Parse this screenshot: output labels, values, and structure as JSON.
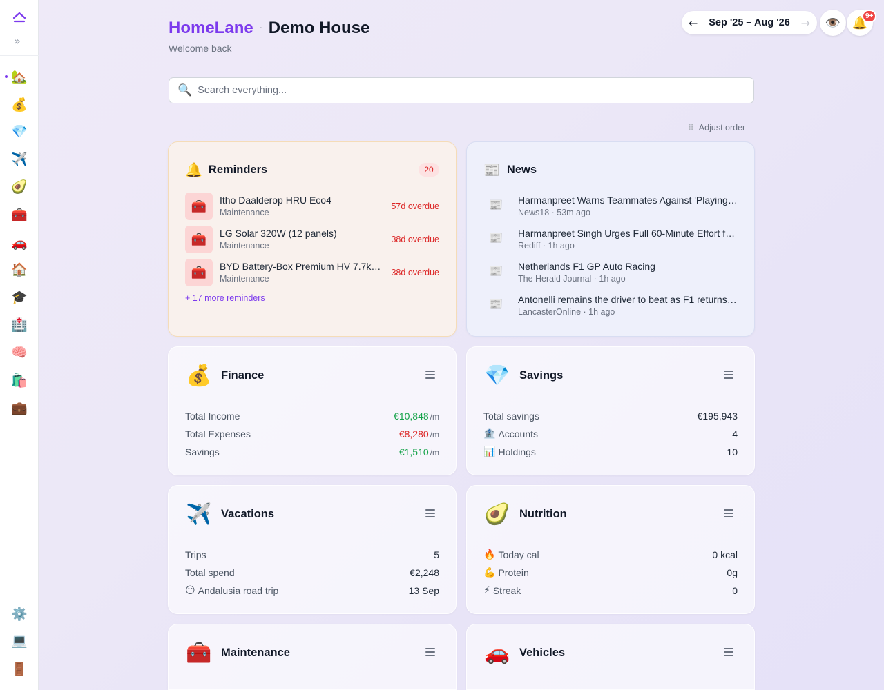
{
  "sidebar": {
    "logo": "homelane-logo",
    "expand": "»",
    "items": [
      {
        "icon": "🏡",
        "name": "house-icon",
        "active": true
      },
      {
        "icon": "💰",
        "name": "money-bag-icon"
      },
      {
        "icon": "💎",
        "name": "gem-icon"
      },
      {
        "icon": "✈️",
        "name": "airplane-icon"
      },
      {
        "icon": "🥑",
        "name": "avocado-icon"
      },
      {
        "icon": "🧰",
        "name": "toolbox-icon"
      },
      {
        "icon": "🚗",
        "name": "car-icon"
      },
      {
        "icon": "🏠",
        "name": "home-icon"
      },
      {
        "icon": "🎓",
        "name": "graduation-cap-icon"
      },
      {
        "icon": "🏥",
        "name": "hospital-icon"
      },
      {
        "icon": "🧠",
        "name": "brain-icon"
      },
      {
        "icon": "🛍️",
        "name": "shopping-bags-icon"
      },
      {
        "icon": "💼",
        "name": "briefcase-icon"
      }
    ],
    "bottom": [
      {
        "icon": "⚙️",
        "name": "gear-icon"
      },
      {
        "icon": "💻",
        "name": "laptop-icon"
      },
      {
        "icon": "🚪",
        "name": "door-icon"
      }
    ]
  },
  "header": {
    "app_name": "HomeLane",
    "separator": "·",
    "house_name": "Demo House",
    "welcome": "Welcome back",
    "range": "Sep '25 – Aug '26",
    "prev_arrow": "←",
    "next_arrow": "→",
    "eye": "👁️",
    "bell": "🔔",
    "notif_count": "9+"
  },
  "search": {
    "icon": "🔍",
    "placeholder": "Search everything..."
  },
  "adjust": {
    "grip": "⠿",
    "label": "Adjust order"
  },
  "reminders": {
    "icon": "🔔",
    "title": "Reminders",
    "count": "20",
    "items": [
      {
        "icon": "🧰",
        "name": "Itho Daalderop HRU Eco4",
        "category": "Maintenance",
        "status": "57d overdue"
      },
      {
        "icon": "🧰",
        "name": "LG Solar 320W (12 panels)",
        "category": "Maintenance",
        "status": "38d overdue"
      },
      {
        "icon": "🧰",
        "name": "BYD Battery-Box Premium HV 7.7kWh",
        "category": "Maintenance",
        "status": "38d overdue"
      }
    ],
    "more": "+ 17 more reminders"
  },
  "news": {
    "icon": "📰",
    "title": "News",
    "items": [
      {
        "icon": "📰",
        "title": "Harmanpreet Warns Teammates Against 'Playing Safe'",
        "meta": "News18 · 53m ago"
      },
      {
        "icon": "📰",
        "title": "Harmanpreet Singh Urges Full 60-Minute Effort from Team",
        "meta": "Rediff · 1h ago"
      },
      {
        "icon": "📰",
        "title": "Netherlands F1 GP Auto Racing",
        "meta": "The Herald Journal · 1h ago"
      },
      {
        "icon": "📰",
        "title": "Antonelli remains the driver to beat as F1 returns to Europe",
        "meta": "LancasterOnline · 1h ago"
      }
    ]
  },
  "finance": {
    "icon": "💰",
    "title": "Finance",
    "rows": [
      {
        "label": "Total Income",
        "value": "€10,848",
        "unit": "/m",
        "color": "green"
      },
      {
        "label": "Total Expenses",
        "value": "€8,280",
        "unit": "/m",
        "color": "red"
      },
      {
        "label": "Savings",
        "value": "€1,510",
        "unit": "/m",
        "color": "green"
      }
    ]
  },
  "savings": {
    "icon": "💎",
    "title": "Savings",
    "rows": [
      {
        "emoji": "",
        "label": "Total savings",
        "value": "€195,943"
      },
      {
        "emoji": "🏦",
        "label": "Accounts",
        "value": "4"
      },
      {
        "emoji": "📊",
        "label": "Holdings",
        "value": "10"
      }
    ]
  },
  "vacations": {
    "icon": "✈️",
    "title": "Vacations",
    "rows": [
      {
        "emoji": "",
        "label": "Trips",
        "value": "5"
      },
      {
        "emoji": "",
        "label": "Total spend",
        "value": "€2,248"
      },
      {
        "emoji": "😶",
        "label": "Andalusia road trip",
        "value": "13 Sep"
      }
    ]
  },
  "nutrition": {
    "icon": "🥑",
    "title": "Nutrition",
    "rows": [
      {
        "emoji": "🔥",
        "label": "Today cal",
        "value": "0 kcal"
      },
      {
        "emoji": "💪",
        "label": "Protein",
        "value": "0g"
      },
      {
        "emoji": "⚡",
        "label": "Streak",
        "value": "0"
      }
    ]
  },
  "maintenance": {
    "icon": "🧰",
    "title": "Maintenance"
  },
  "vehicles": {
    "icon": "🚗",
    "title": "Vehicles"
  },
  "colors": {
    "accent": "#7c3aed",
    "overdue": "#dc2626",
    "positive": "#16a34a",
    "negative": "#dc2626"
  }
}
